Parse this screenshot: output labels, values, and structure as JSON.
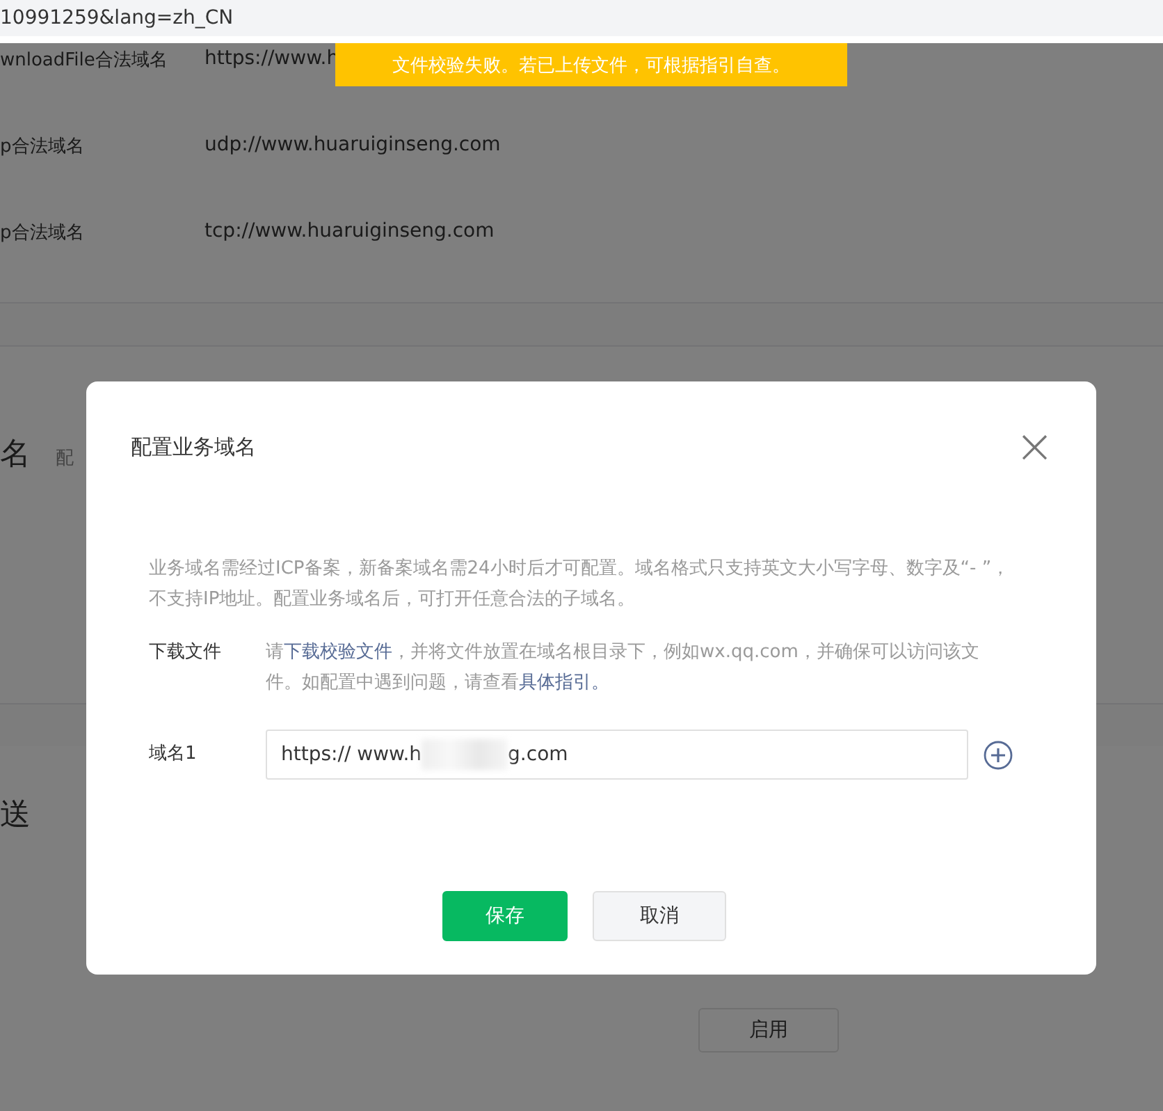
{
  "address_bar": {
    "url": "10991259&lang=zh_CN"
  },
  "domain_rows": [
    {
      "label": "wnloadFile合法域名",
      "value": "https://www.h"
    },
    {
      "label": "p合法域名",
      "value": "udp://www.huaruiginseng.com"
    },
    {
      "label": "p合法域名",
      "value": "tcp://www.huaruiginseng.com"
    }
  ],
  "section_1": {
    "title": "名",
    "subtitle": "配"
  },
  "section_2": {
    "title": "送"
  },
  "enable_button": "启用",
  "toast": {
    "text": "文件校验失败。若已上传文件，可根据指引自查。"
  },
  "dialog": {
    "title": "配置业务域名",
    "close": "×",
    "description": "业务域名需经过ICP备案，新备案域名需24小时后才可配置。域名格式只支持英文大小写字母、数字及“- ”，不支持IP地址。配置业务域名后，可打开任意合法的子域名。",
    "download_label": "下载文件",
    "download_text": [
      {
        "kind": "text",
        "text": "请"
      },
      {
        "kind": "link",
        "text": "下载校验文件"
      },
      {
        "kind": "text",
        "text": "，并将文件放置在域名根目录下，例如wx.qq.com，并确保可以访问该文件。如配置中遇到问题，请查看"
      },
      {
        "kind": "link",
        "text": "具体指引。"
      }
    ],
    "domain_label": "域名1",
    "domain_value_start": "https:// www.h",
    "domain_value_end": "g.com",
    "buttons": [
      {
        "label": "保存",
        "kind": "primary"
      },
      {
        "label": "取消",
        "kind": "default"
      }
    ]
  }
}
